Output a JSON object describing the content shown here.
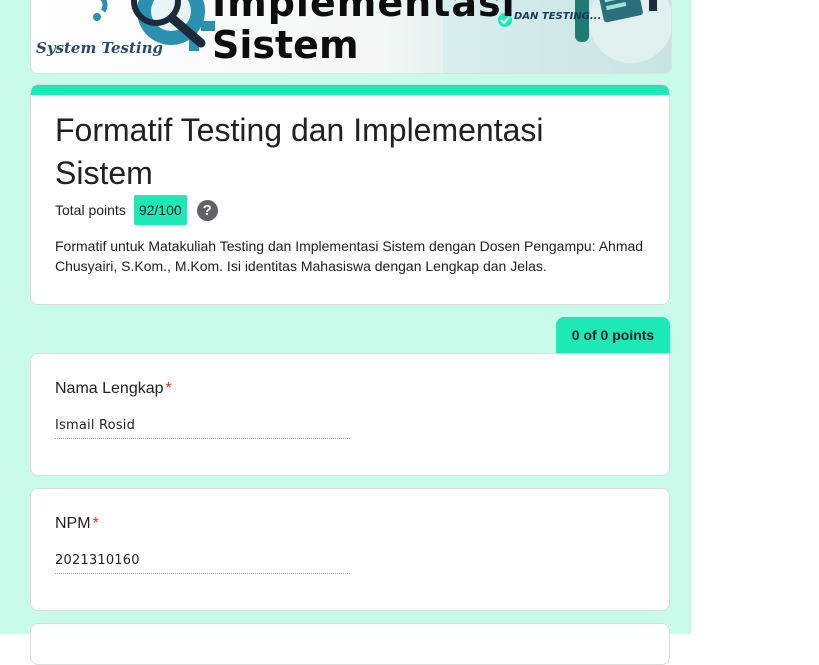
{
  "banner": {
    "title_line1": "Implementasi",
    "title_line2": "Sistem",
    "tag_left": "System Testing",
    "tag_right": "DAN TESTING..."
  },
  "form": {
    "title": "Formatif Testing dan Implementasi Sistem",
    "points_label": "Total points",
    "points_value": "92/100",
    "help_glyph": "?",
    "description": "Formatif untuk Matakuliah Testing dan Implementasi Sistem dengan Dosen Pengampu: Ahmad Chusyairi, S.Kom., M.Kom. Isi identitas Mahasiswa dengan Lengkap dan Jelas."
  },
  "section": {
    "score": "0 of 0 points"
  },
  "questions": [
    {
      "label": "Nama Lengkap",
      "required_mark": "*",
      "answer": "Ismail Rosid"
    },
    {
      "label": "NPM",
      "required_mark": "*",
      "answer": "2021310160"
    }
  ],
  "colors": {
    "background": "#c9fbea",
    "accent": "#1de9b6",
    "required": "#d93025"
  },
  "icons": [
    "help-circle-icon",
    "magnifier-icon",
    "gear-icon",
    "check-icon"
  ]
}
